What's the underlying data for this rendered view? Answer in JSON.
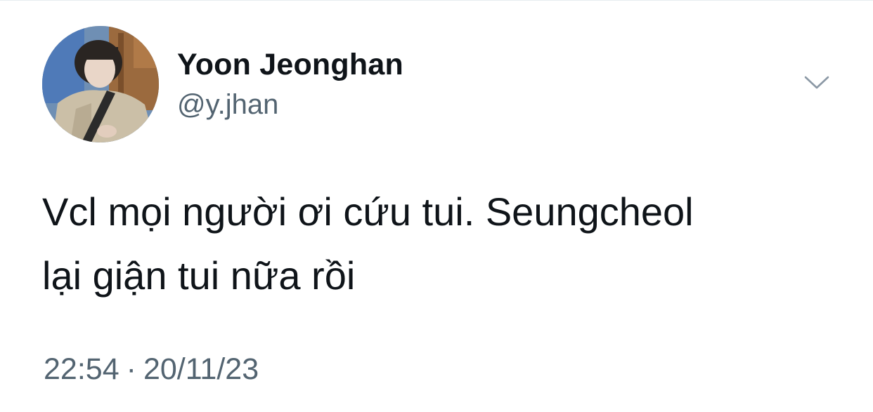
{
  "tweet": {
    "author": {
      "display_name": "Yoon Jeonghan",
      "handle": "@y.jhan",
      "avatar_icon": "profile-photo"
    },
    "text": "Vcl mọi người ơi cứu tui. Seungcheol\nlại giận tui nữa rồi",
    "time": "22:54",
    "separator": "·",
    "date": "20/11/23",
    "more_icon": "chevron-down-icon"
  },
  "colors": {
    "text_primary": "#0f1419",
    "text_secondary": "#536471",
    "icon": "#8b98a5",
    "background": "#ffffff"
  }
}
